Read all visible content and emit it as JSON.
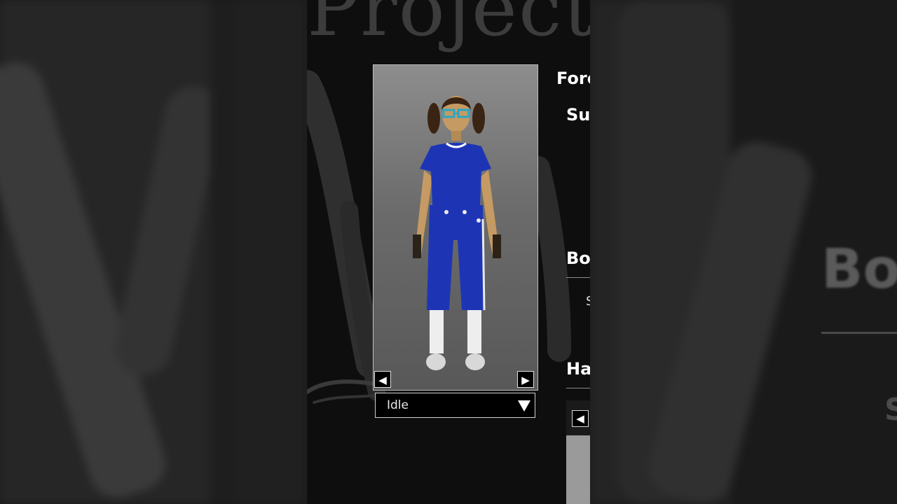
{
  "logo_text": "Project",
  "preview": {
    "prev_arrow": "◀",
    "next_arrow": "▶",
    "animation_dropdown": {
      "selected": "Idle"
    }
  },
  "labels": {
    "fore": "Fore",
    "sun": "Sun",
    "bo": "Bo",
    "ha": "Ha",
    "s_small": "S"
  },
  "mini_arrow": "◀",
  "blurred_side": {
    "bo": "Bo",
    "s": "S"
  },
  "colors": {
    "outfit_blue": "#1d35b5",
    "glasses": "#2aa6c4",
    "skin": "#c59a63",
    "hair": "#3a2414"
  }
}
